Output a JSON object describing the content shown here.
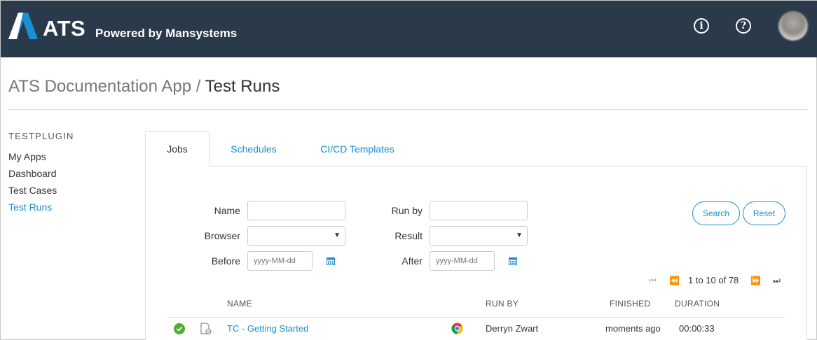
{
  "header": {
    "logo_text": "ATS",
    "tagline": "Powered by Mansystems",
    "info_icon": "info-icon",
    "help_icon": "help-icon",
    "avatar": "user-avatar",
    "bg_color": "#2b3a4b",
    "logo_color": "#1a8fd1"
  },
  "breadcrumb": {
    "parent": "ATS Documentation App /",
    "current": "Test Runs"
  },
  "sidebar": {
    "heading": "TESTPLUGIN",
    "items": [
      {
        "label": "My Apps",
        "active": false
      },
      {
        "label": "Dashboard",
        "active": false
      },
      {
        "label": "Test Cases",
        "active": false
      },
      {
        "label": "Test Runs",
        "active": true
      }
    ]
  },
  "tabs": [
    {
      "label": "Jobs",
      "active": true
    },
    {
      "label": "Schedules",
      "active": false
    },
    {
      "label": "CI/CD Templates",
      "active": false
    }
  ],
  "filters": {
    "name_label": "Name",
    "run_by_label": "Run by",
    "browser_label": "Browser",
    "result_label": "Result",
    "before_label": "Before",
    "after_label": "After",
    "date_placeholder": "yyyy-MM-dd",
    "name_value": "",
    "run_by_value": "",
    "browser_value": "",
    "result_value": ""
  },
  "actions": {
    "search_label": "Search",
    "reset_label": "Reset"
  },
  "pagination": {
    "text": "1 to 10 of 78"
  },
  "table": {
    "columns": [
      "NAME",
      "RUN BY",
      "FINISHED",
      "DURATION"
    ],
    "rows": [
      {
        "status": "passed",
        "name": "TC - Getting Started",
        "browser_icon": "chrome-icon",
        "run_by": "Derryn Zwart",
        "finished": "moments ago",
        "duration": "00:00:33"
      }
    ]
  },
  "colors": {
    "accent": "#1a8fd1",
    "success": "#4caf2d"
  }
}
